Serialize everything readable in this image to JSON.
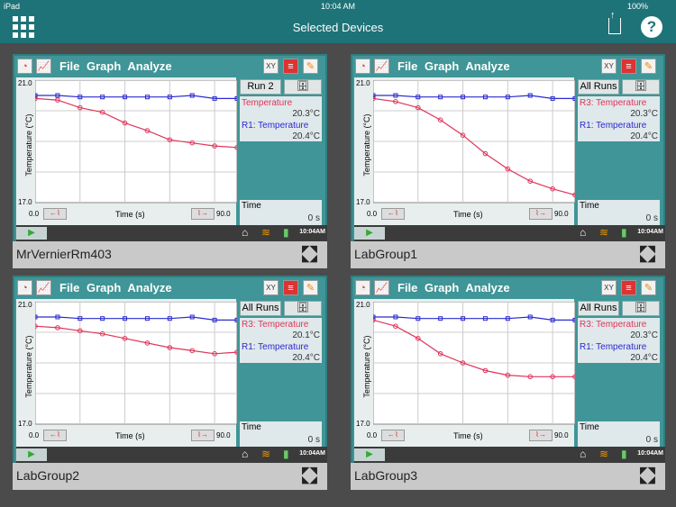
{
  "status_bar": {
    "device": "iPad",
    "time": "10:04 AM",
    "battery": "100%"
  },
  "header": {
    "title": "Selected Devices"
  },
  "panel_common": {
    "menu": "File  Graph  Analyze",
    "y_axis": "Temperature (°C)",
    "y_max": "21.0",
    "y_min": "17.0",
    "x_label": "Time (s)",
    "x_min": "0.0",
    "x_max": "90.0",
    "time_label": "Time",
    "time_value": "0 s",
    "clock": "10:04AM"
  },
  "colors": {
    "red": "#e0345a",
    "blue": "#2a2ad0",
    "teal": "#1e7378"
  },
  "devices": [
    {
      "name": "MrVernierRm403",
      "run": "Run 2",
      "sensor1": "Temperature",
      "value1": "20.3°C",
      "sensor2": "R1: Temperature",
      "value2": "20.4°C"
    },
    {
      "name": "LabGroup1",
      "run": "All Runs",
      "sensor1": "R3: Temperature",
      "value1": "20.3°C",
      "sensor2": "R1: Temperature",
      "value2": "20.4°C"
    },
    {
      "name": "LabGroup2",
      "run": "All Runs",
      "sensor1": "R3: Temperature",
      "value1": "20.1°C",
      "sensor2": "R1: Temperature",
      "value2": "20.4°C"
    },
    {
      "name": "LabGroup3",
      "run": "All Runs",
      "sensor1": "R3: Temperature",
      "value1": "20.3°C",
      "sensor2": "R1: Temperature",
      "value2": "20.4°C"
    }
  ],
  "chart_data": [
    {
      "type": "line",
      "xlabel": "Time (s)",
      "ylabel": "Temperature (°C)",
      "xlim": [
        0,
        90
      ],
      "ylim": [
        17,
        21
      ],
      "x": [
        0,
        10,
        20,
        30,
        40,
        50,
        60,
        70,
        80,
        90
      ],
      "series": [
        {
          "name": "Temperature",
          "values": [
            20.4,
            20.35,
            20.1,
            19.95,
            19.6,
            19.35,
            19.05,
            18.95,
            18.85,
            18.8
          ]
        },
        {
          "name": "R1: Temperature",
          "values": [
            20.5,
            20.5,
            20.45,
            20.45,
            20.45,
            20.45,
            20.45,
            20.5,
            20.4,
            20.4
          ]
        }
      ]
    },
    {
      "type": "line",
      "xlabel": "Time (s)",
      "ylabel": "Temperature (°C)",
      "xlim": [
        0,
        90
      ],
      "ylim": [
        17,
        21
      ],
      "x": [
        0,
        10,
        20,
        30,
        40,
        50,
        60,
        70,
        80,
        90
      ],
      "series": [
        {
          "name": "R3: Temperature",
          "values": [
            20.4,
            20.3,
            20.1,
            19.7,
            19.2,
            18.6,
            18.1,
            17.7,
            17.45,
            17.25
          ]
        },
        {
          "name": "R1: Temperature",
          "values": [
            20.5,
            20.5,
            20.45,
            20.45,
            20.45,
            20.45,
            20.45,
            20.5,
            20.4,
            20.4
          ]
        }
      ]
    },
    {
      "type": "line",
      "xlabel": "Time (s)",
      "ylabel": "Temperature (°C)",
      "xlim": [
        0,
        90
      ],
      "ylim": [
        17,
        21
      ],
      "x": [
        0,
        10,
        20,
        30,
        40,
        50,
        60,
        70,
        80,
        90
      ],
      "series": [
        {
          "name": "R3: Temperature",
          "values": [
            20.2,
            20.15,
            20.05,
            19.95,
            19.8,
            19.65,
            19.5,
            19.4,
            19.3,
            19.35
          ]
        },
        {
          "name": "R1: Temperature",
          "values": [
            20.5,
            20.5,
            20.45,
            20.45,
            20.45,
            20.45,
            20.45,
            20.5,
            20.4,
            20.4
          ]
        }
      ]
    },
    {
      "type": "line",
      "xlabel": "Time (s)",
      "ylabel": "Temperature (°C)",
      "xlim": [
        0,
        90
      ],
      "ylim": [
        17,
        21
      ],
      "x": [
        0,
        10,
        20,
        30,
        40,
        50,
        60,
        70,
        80,
        90
      ],
      "series": [
        {
          "name": "R3: Temperature",
          "values": [
            20.4,
            20.2,
            19.8,
            19.3,
            19.0,
            18.75,
            18.6,
            18.55,
            18.55,
            18.55
          ]
        },
        {
          "name": "R1: Temperature",
          "values": [
            20.5,
            20.5,
            20.45,
            20.45,
            20.45,
            20.45,
            20.45,
            20.5,
            20.4,
            20.4
          ]
        }
      ]
    }
  ]
}
